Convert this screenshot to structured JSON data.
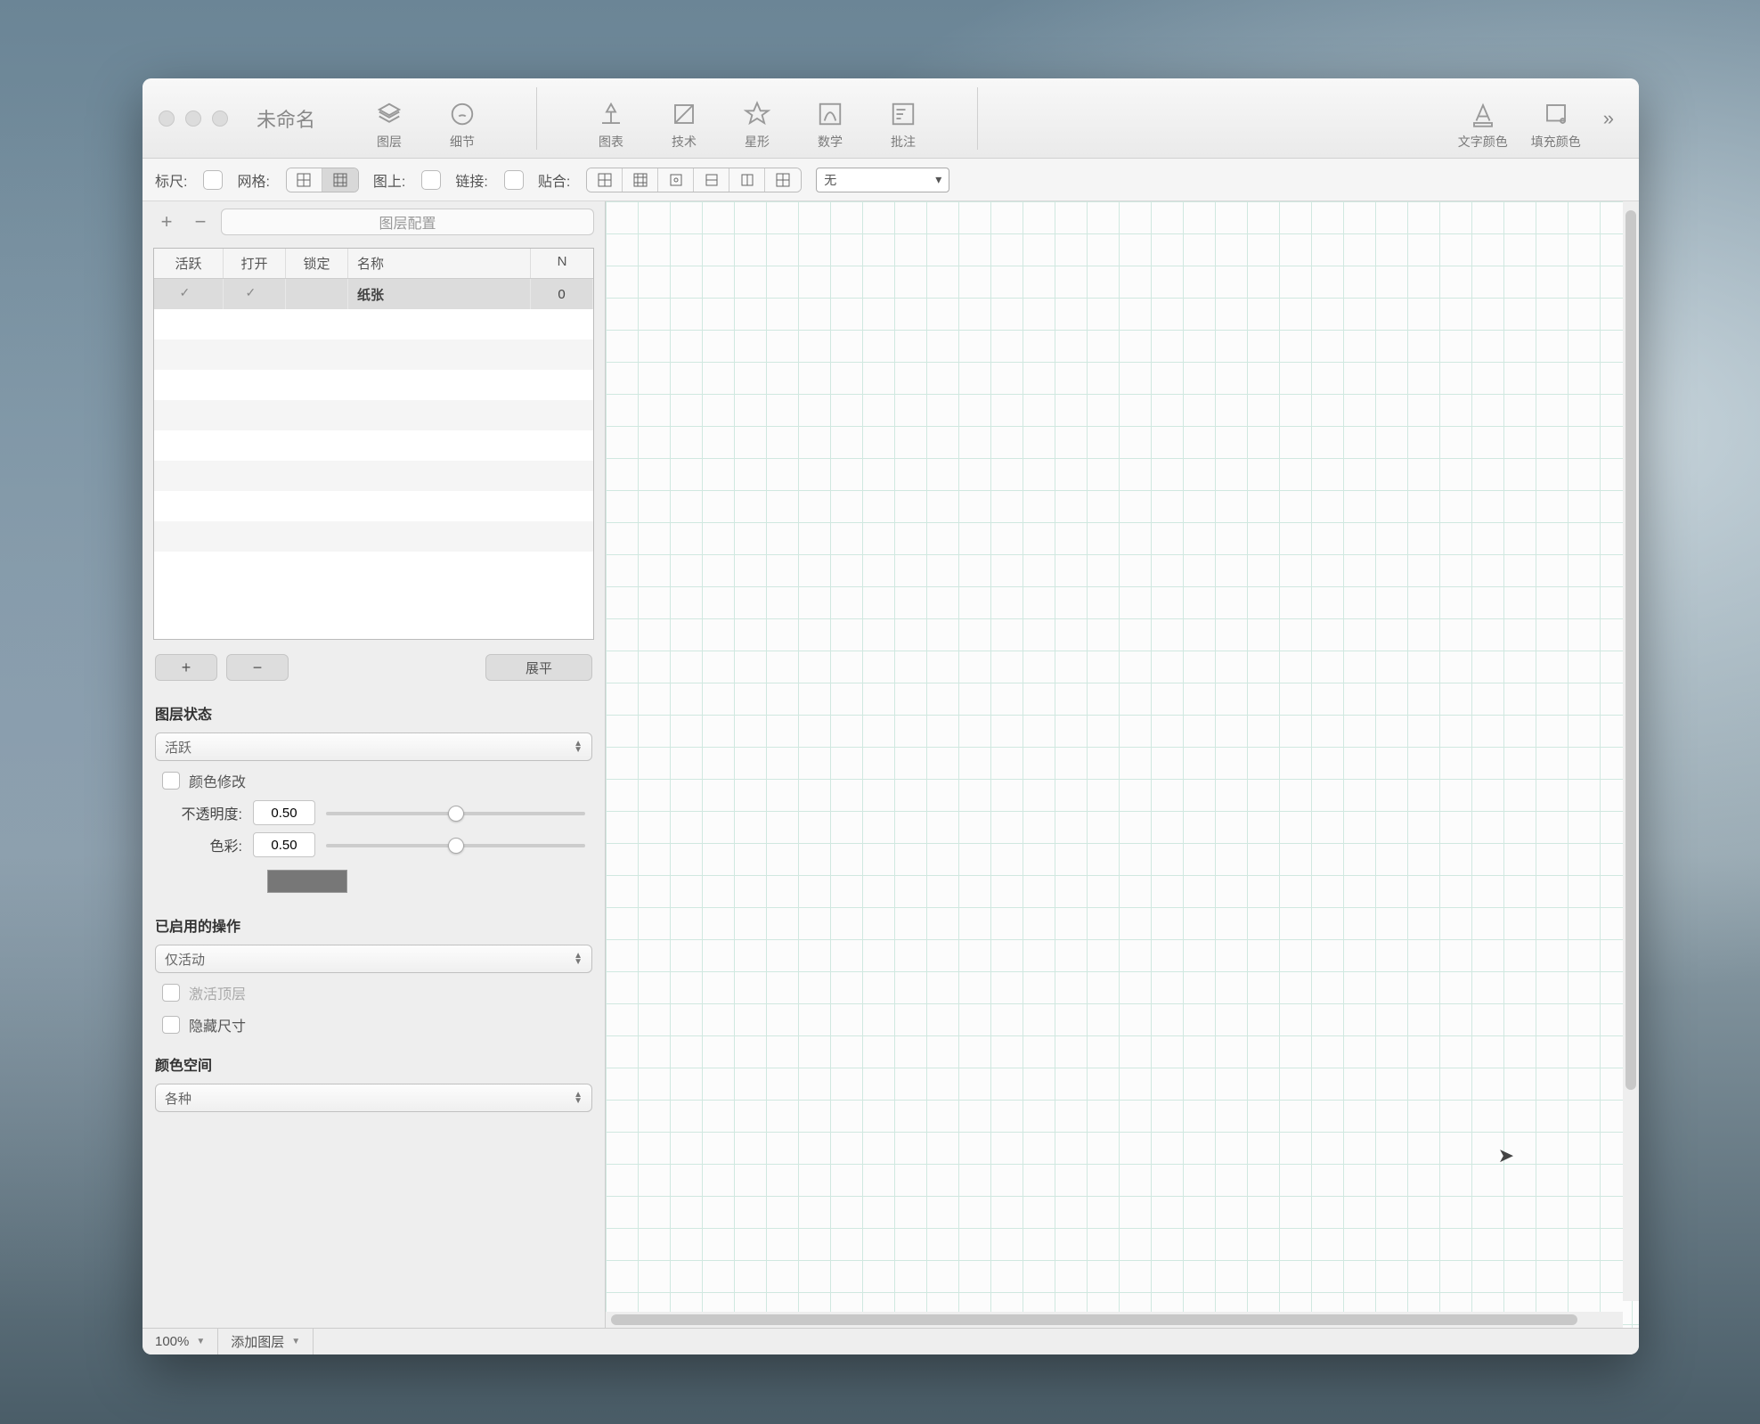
{
  "window": {
    "title": "未命名"
  },
  "toolbar": {
    "layers": "图层",
    "details": "细节",
    "chart": "图表",
    "technology": "技术",
    "star": "星形",
    "math": "数学",
    "annotation": "批注",
    "text_color": "文字颜色",
    "fill_color": "填充颜色"
  },
  "options": {
    "ruler": "标尺:",
    "grid": "网格:",
    "on_image": "图上:",
    "link": "链接:",
    "snap": "贴合:",
    "none": "无"
  },
  "sidebar": {
    "layer_config": "图层配置",
    "table_headers": {
      "active": "活跃",
      "open": "打开",
      "lock": "锁定",
      "name": "名称",
      "n": "N"
    },
    "rows": [
      {
        "active": true,
        "open": true,
        "lock": false,
        "name": "纸张",
        "n": "0"
      }
    ],
    "add": "+",
    "remove": "−",
    "flatten": "展平",
    "layer_state": "图层状态",
    "state_value": "活跃",
    "color_modify": "颜色修改",
    "opacity_label": "不透明度:",
    "opacity_value": "0.50",
    "color_label": "色彩:",
    "color_value": "0.50",
    "enabled_ops": "已启用的操作",
    "enabled_value": "仅活动",
    "activate_top": "激活顶层",
    "hide_dims": "隐藏尺寸",
    "color_space": "颜色空间",
    "color_space_value": "各种"
  },
  "status": {
    "zoom": "100%",
    "add_layer": "添加图层"
  }
}
